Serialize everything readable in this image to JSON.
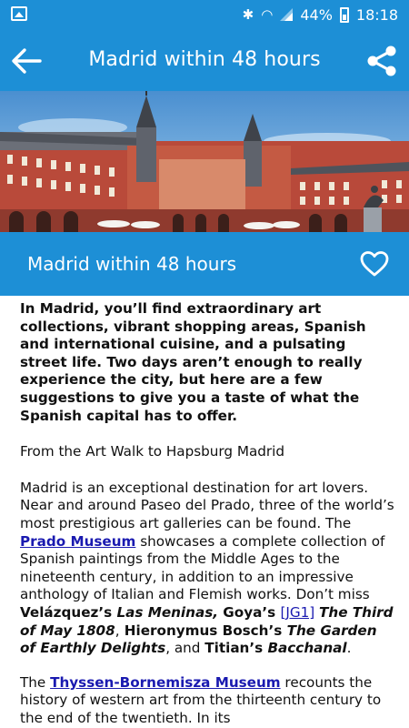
{
  "status_bar": {
    "battery": "44%",
    "time": "18:18"
  },
  "app_bar": {
    "title": "Madrid within 48 hours"
  },
  "card": {
    "title": "Madrid within 48 hours"
  },
  "article": {
    "intro": "In Madrid, you’ll find extraordinary art collections, vibrant shopping areas, Spanish and international cuisine, and a pulsating street life. Two days aren’t enough to really experience the city, but here are a few suggestions to give you a taste of what the Spanish capital has to offer.",
    "section_title": "From the Art Walk to Hapsburg Madrid",
    "p1_a": "Madrid is an exceptional destination for art lovers. Near and around Paseo del Prado, three of the world’s most prestigious art galleries can be found. The ",
    "p1_link_prado": "Prado Museum",
    "p1_b": " showcases a complete collection of Spanish paintings from the Middle Ages to the nineteenth century, in addition to an impressive anthology of Italian and Flemish works. Don’t miss ",
    "p1_velazquez": "Velázquez’s ",
    "p1_las_meninas": "Las Meninas,",
    "p1_goya": " Goya’s ",
    "p1_jg1": "[JG1]",
    "p1_sp1": " ",
    "p1_third_may": "The Third of May 1808",
    "p1_comma1": ",",
    "p1_bosch": " Hieronymus Bosch’s ",
    "p1_garden": "The Garden of Earthly Delights",
    "p1_and": ", and ",
    "p1_titian": "Titian’s ",
    "p1_bacchanal": "Bacchanal",
    "p1_end": ".",
    "p2_a": "The ",
    "p2_link_thyssen": "Thyssen-Bornemisza Museum",
    "p2_b": " recounts the history of western art from the thirteenth century to the end of the twentieth. In its"
  },
  "colors": {
    "primary": "#1d8fd6",
    "link": "#1a1ab0"
  },
  "icons": {
    "back": "arrow-left-icon",
    "share": "share-icon",
    "favorite": "heart-outline-icon"
  }
}
